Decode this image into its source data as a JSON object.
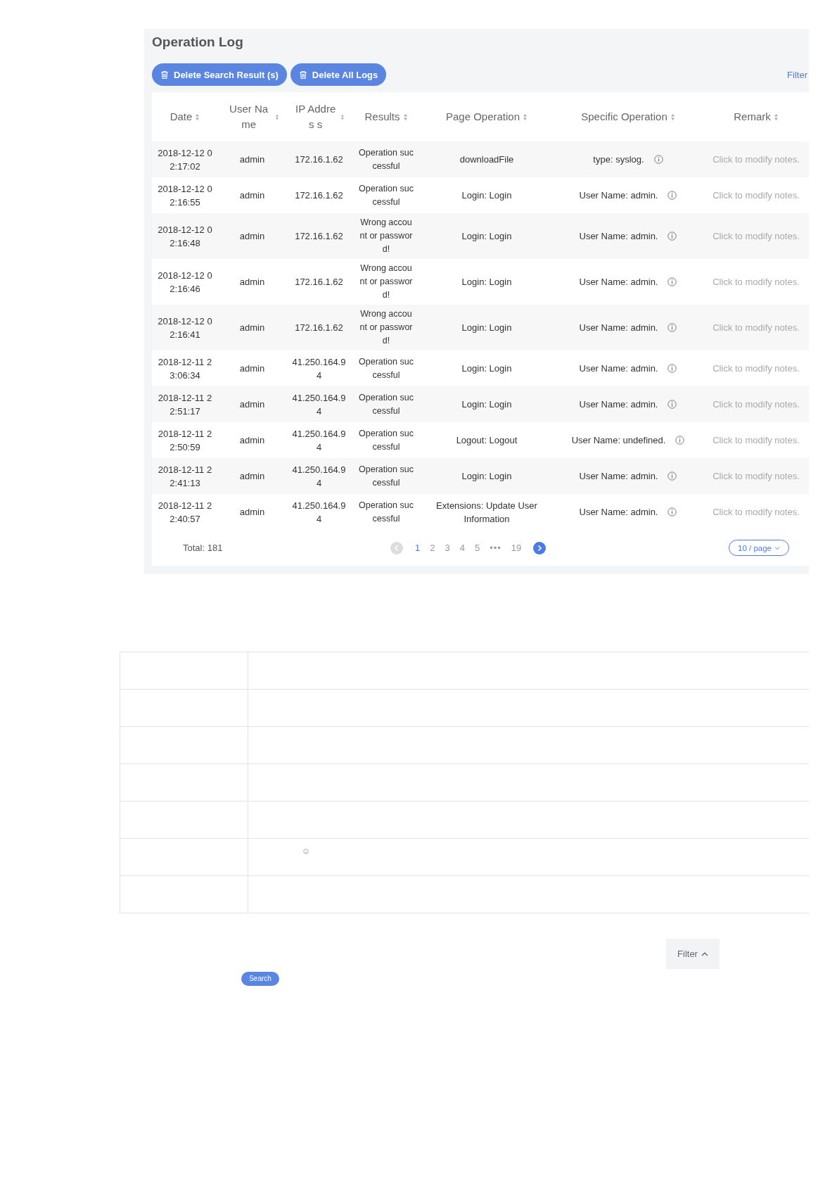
{
  "panel": {
    "title": "Operation Log",
    "actions": [
      {
        "kind": "delete",
        "label": "Delete Search Result (s)"
      },
      {
        "kind": "delete",
        "label": "Delete All Logs"
      }
    ],
    "filter_link": "Filter"
  },
  "table": {
    "headers": [
      "Date",
      "User Na me",
      "IP Addres s",
      "Results",
      "Page Operation",
      "Specific Operation",
      "Remark"
    ],
    "rows": [
      {
        "date": "2018-12-12 02:17:02",
        "user": "admin",
        "ip": "172.16.1.62",
        "result": "Operation successful",
        "page_operation": "downloadFile",
        "specific_operation": "type: syslog.",
        "remark": "Click to modify notes."
      },
      {
        "date": "2018-12-12 02:16:55",
        "user": "admin",
        "ip": "172.16.1.62",
        "result": "Operation successful",
        "page_operation": "Login: Login",
        "specific_operation": "User Name: admin.",
        "remark": "Click to modify notes."
      },
      {
        "date": "2018-12-12 02:16:48",
        "user": "admin",
        "ip": "172.16.1.62",
        "result": "Wrong account or password!",
        "page_operation": "Login: Login",
        "specific_operation": "User Name: admin.",
        "remark": "Click to modify notes."
      },
      {
        "date": "2018-12-12 02:16:46",
        "user": "admin",
        "ip": "172.16.1.62",
        "result": "Wrong account or password!",
        "page_operation": "Login: Login",
        "specific_operation": "User Name: admin.",
        "remark": "Click to modify notes."
      },
      {
        "date": "2018-12-12 02:16:41",
        "user": "admin",
        "ip": "172.16.1.62",
        "result": "Wrong account or password!",
        "page_operation": "Login: Login",
        "specific_operation": "User Name: admin.",
        "remark": "Click to modify notes."
      },
      {
        "date": "2018-12-11 23:06:34",
        "user": "admin",
        "ip": "41.250.164.94",
        "result": "Operation successful",
        "page_operation": "Login: Login",
        "specific_operation": "User Name: admin.",
        "remark": "Click to modify notes."
      },
      {
        "date": "2018-12-11 22:51:17",
        "user": "admin",
        "ip": "41.250.164.94",
        "result": "Operation successful",
        "page_operation": "Login: Login",
        "specific_operation": "User Name: admin.",
        "remark": "Click to modify notes."
      },
      {
        "date": "2018-12-11 22:50:59",
        "user": "admin",
        "ip": "41.250.164.94",
        "result": "Operation successful",
        "page_operation": "Logout: Logout",
        "specific_operation": "User Name: undefined.",
        "remark": "Click to modify notes."
      },
      {
        "date": "2018-12-11 22:41:13",
        "user": "admin",
        "ip": "41.250.164.94",
        "result": "Operation successful",
        "page_operation": "Login: Login",
        "specific_operation": "User Name: admin.",
        "remark": "Click to modify notes."
      },
      {
        "date": "2018-12-11 22:40:57",
        "user": "admin",
        "ip": "41.250.164.94",
        "result": "Operation successful",
        "page_operation": "Extensions: Update User Information",
        "specific_operation": "User Name: admin.",
        "remark": "Click to modify notes."
      }
    ]
  },
  "pagination": {
    "total": "Total: 181",
    "prev": {
      "disabled": true
    },
    "pages": [
      {
        "label": "1",
        "selected": true
      },
      {
        "label": "2",
        "selected": false
      },
      {
        "label": "3",
        "selected": false
      },
      {
        "label": "4",
        "selected": false
      },
      {
        "label": "5",
        "selected": false
      },
      {
        "label": "•••",
        "selected": false,
        "kind": "ellipsis"
      },
      {
        "label": "19",
        "selected": false
      }
    ],
    "next": {
      "disabled": false
    },
    "page_size": "10 / page"
  },
  "filter_button": {
    "label": "Filter",
    "expanded": true
  },
  "search_button": {
    "label": "Search"
  }
}
